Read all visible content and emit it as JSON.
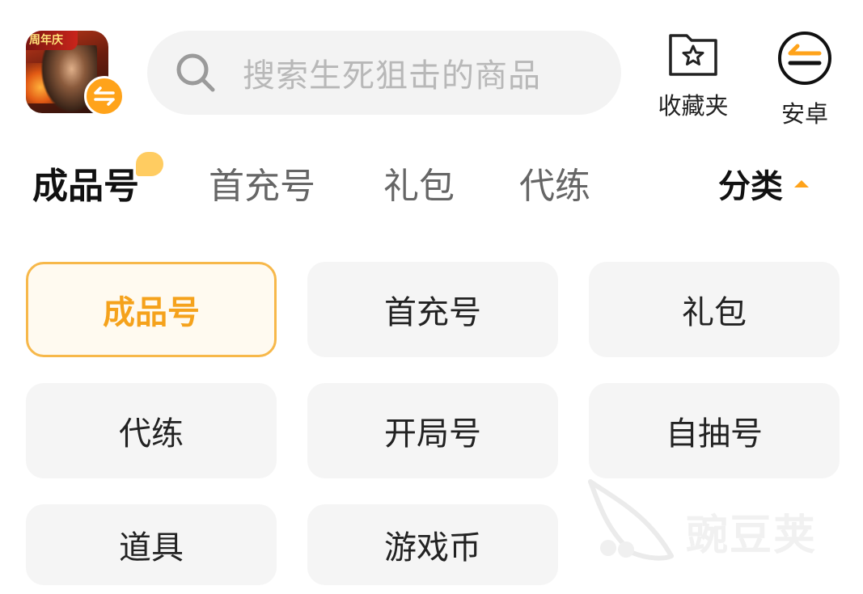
{
  "header": {
    "app_icon_banner": "周年庆",
    "search_placeholder": "搜索生死狙击的商品",
    "favorites_label": "收藏夹",
    "platform_label": "安卓"
  },
  "tabs": {
    "items": [
      {
        "label": "成品号",
        "active": true
      },
      {
        "label": "首充号",
        "active": false
      },
      {
        "label": "礼包",
        "active": false
      },
      {
        "label": "代练",
        "active": false
      }
    ],
    "category_label": "分类"
  },
  "grid": {
    "items": [
      {
        "label": "成品号",
        "active": true
      },
      {
        "label": "首充号",
        "active": false
      },
      {
        "label": "礼包",
        "active": false
      },
      {
        "label": "代练",
        "active": false
      },
      {
        "label": "开局号",
        "active": false
      },
      {
        "label": "自抽号",
        "active": false
      },
      {
        "label": "道具",
        "active": false
      },
      {
        "label": "游戏币",
        "active": false
      }
    ]
  },
  "watermark": {
    "text": "豌豆荚"
  },
  "colors": {
    "accent": "#ffa31a",
    "active_text": "#f5a21c",
    "cell_bg": "#f5f5f5",
    "search_bg": "#f3f3f3"
  },
  "icons": {
    "search": "search-icon",
    "favorites": "star-folder-icon",
    "platform": "swap-arrows-icon",
    "badge": "swap-arrows-icon"
  }
}
